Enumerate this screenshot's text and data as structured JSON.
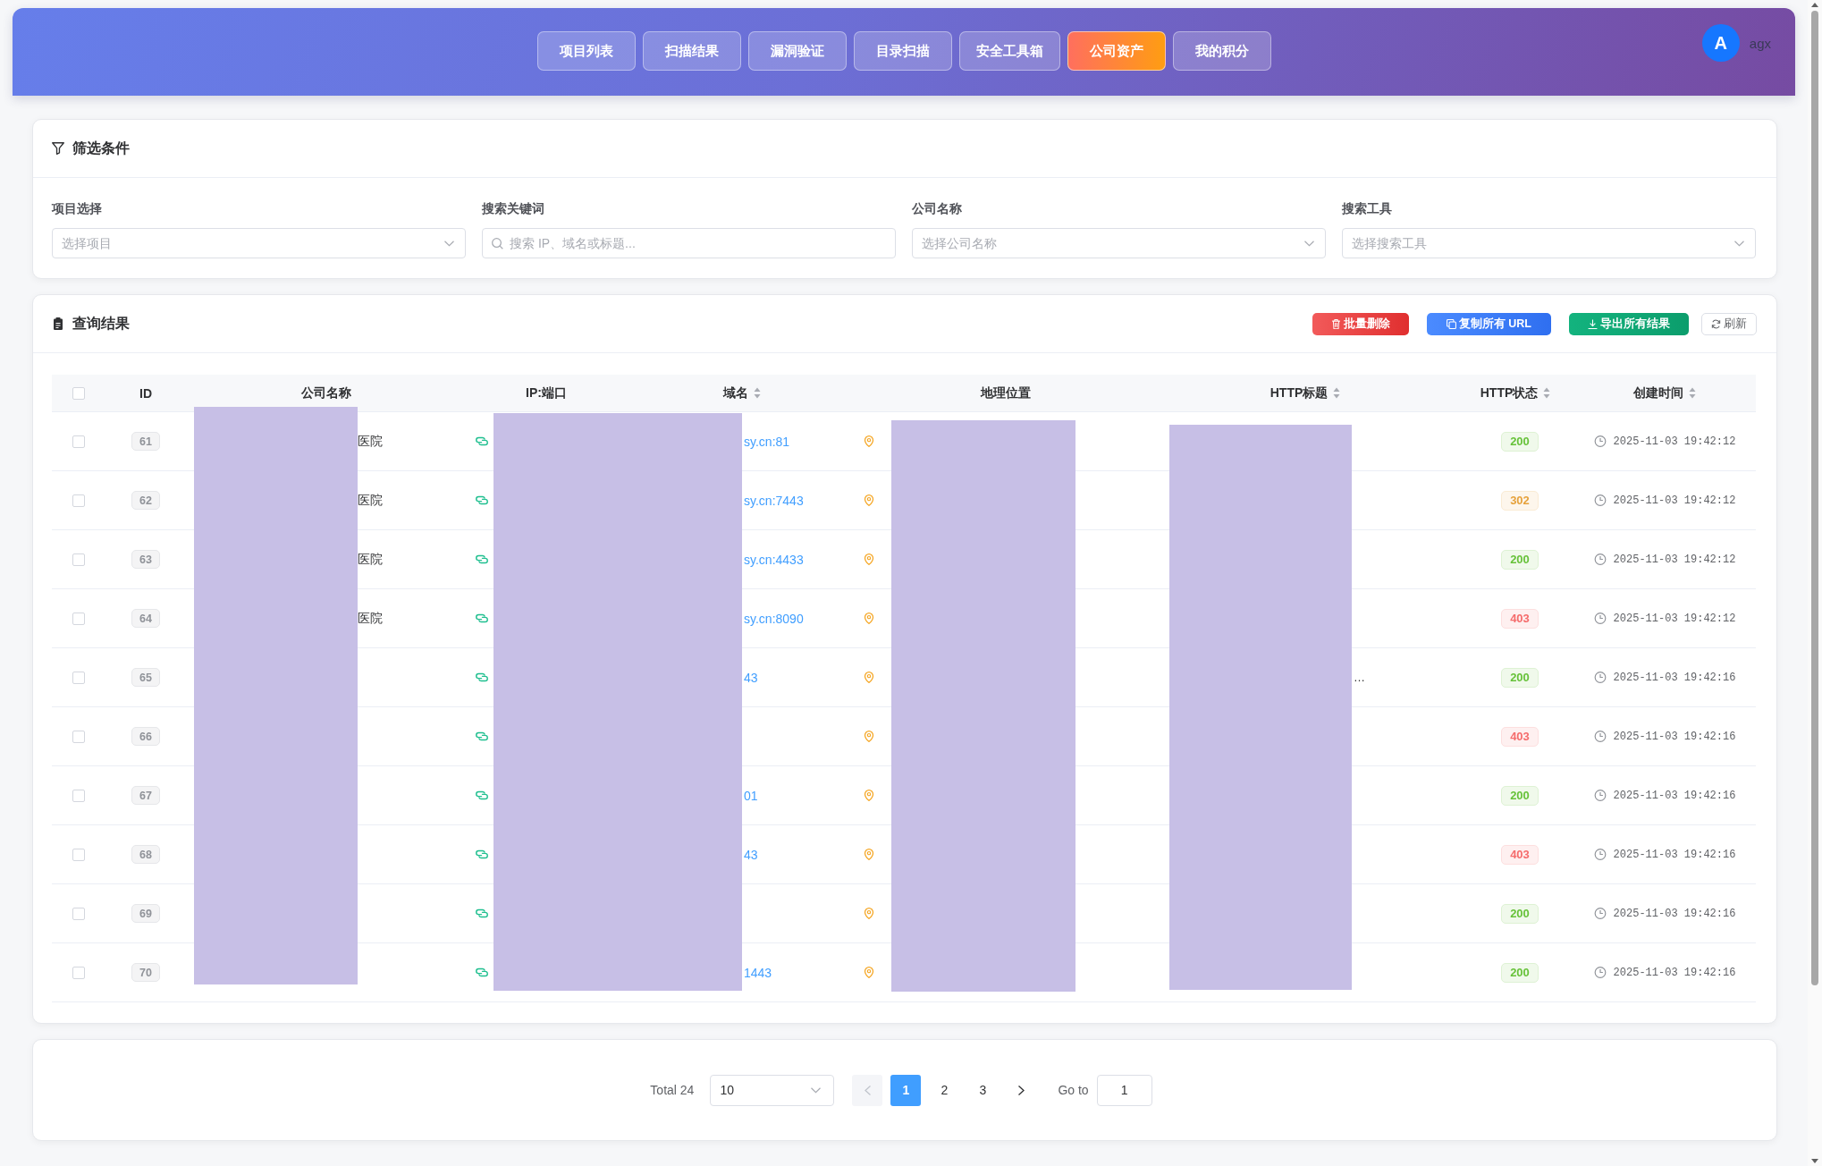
{
  "nav": {
    "items": [
      {
        "label": "项目列表",
        "selected": false
      },
      {
        "label": "扫描结果",
        "selected": false
      },
      {
        "label": "漏洞验证",
        "selected": false
      },
      {
        "label": "目录扫描",
        "selected": false
      },
      {
        "label": "安全工具箱",
        "selected": false
      },
      {
        "label": "公司资产",
        "selected": true
      },
      {
        "label": "我的积分",
        "selected": false
      }
    ],
    "user": {
      "avatar_letter": "A",
      "name": "agx"
    }
  },
  "filters": {
    "title": "筛选条件",
    "fields": [
      {
        "kind": "select",
        "label": "项目选择",
        "placeholder": "选择项目"
      },
      {
        "kind": "search",
        "label": "搜索关键词",
        "placeholder": "搜索 IP、域名或标题..."
      },
      {
        "kind": "select",
        "label": "公司名称",
        "placeholder": "选择公司名称"
      },
      {
        "kind": "select",
        "label": "搜索工具",
        "placeholder": "选择搜索工具"
      }
    ]
  },
  "results": {
    "title": "查询结果",
    "actions": [
      {
        "kind": "danger",
        "label": "批量删除"
      },
      {
        "kind": "primary",
        "label": "复制所有 URL"
      },
      {
        "kind": "success",
        "label": "导出所有结果"
      },
      {
        "kind": "plain",
        "label": "刷新"
      }
    ],
    "table": {
      "select_all_checked": false,
      "columns": [
        {
          "label": "ID",
          "sortable": false
        },
        {
          "label": "公司名称",
          "sortable": false
        },
        {
          "label": "IP:端口",
          "sortable": false
        },
        {
          "label": "域名",
          "sortable": true
        },
        {
          "label": "地理位置",
          "sortable": false
        },
        {
          "label": "HTTP标题",
          "sortable": true
        },
        {
          "label": "HTTP状态",
          "sortable": true
        },
        {
          "label": "创建时间",
          "sortable": true
        }
      ],
      "rows": [
        {
          "checked": false,
          "id": "61",
          "company": "医院",
          "domain": "sy.cn:81",
          "status": {
            "text": "200",
            "color": "#67c23a"
          },
          "created": "2025-11-03 19:42:12"
        },
        {
          "checked": false,
          "id": "62",
          "company": "医院",
          "domain": "sy.cn:7443",
          "status": {
            "text": "302",
            "color": "#e6a23c"
          },
          "created": "2025-11-03 19:42:12"
        },
        {
          "checked": false,
          "id": "63",
          "company": "医院",
          "domain": "sy.cn:4433",
          "status": {
            "text": "200",
            "color": "#67c23a"
          },
          "created": "2025-11-03 19:42:12"
        },
        {
          "checked": false,
          "id": "64",
          "company": "医院",
          "domain": "sy.cn:8090",
          "status": {
            "text": "403",
            "color": "#f56c6c"
          },
          "created": "2025-11-03 19:42:12"
        },
        {
          "checked": false,
          "id": "65",
          "domain": "43",
          "title": "…",
          "status": {
            "text": "200",
            "color": "#67c23a"
          },
          "created": "2025-11-03 19:42:16"
        },
        {
          "checked": false,
          "id": "66",
          "status": {
            "text": "403",
            "color": "#f56c6c"
          },
          "created": "2025-11-03 19:42:16"
        },
        {
          "checked": false,
          "id": "67",
          "domain": "01",
          "status": {
            "text": "200",
            "color": "#67c23a"
          },
          "created": "2025-11-03 19:42:16"
        },
        {
          "checked": false,
          "id": "68",
          "domain": "43",
          "status": {
            "text": "403",
            "color": "#f56c6c"
          },
          "created": "2025-11-03 19:42:16"
        },
        {
          "checked": false,
          "id": "69",
          "status": {
            "text": "200",
            "color": "#67c23a"
          },
          "created": "2025-11-03 19:42:16"
        },
        {
          "checked": false,
          "id": "70",
          "domain": "1443",
          "status": {
            "text": "200",
            "color": "#67c23a"
          },
          "created": "2025-11-03 19:42:16"
        }
      ]
    }
  },
  "pagination": {
    "total": "Total 24",
    "page_size": "10",
    "prev_disabled": true,
    "pages": [
      {
        "label": "1",
        "selected": true
      },
      {
        "label": "2",
        "selected": false
      },
      {
        "label": "3",
        "selected": false
      }
    ],
    "next_disabled": false,
    "goto_label": "Go to",
    "goto_value": "1"
  }
}
